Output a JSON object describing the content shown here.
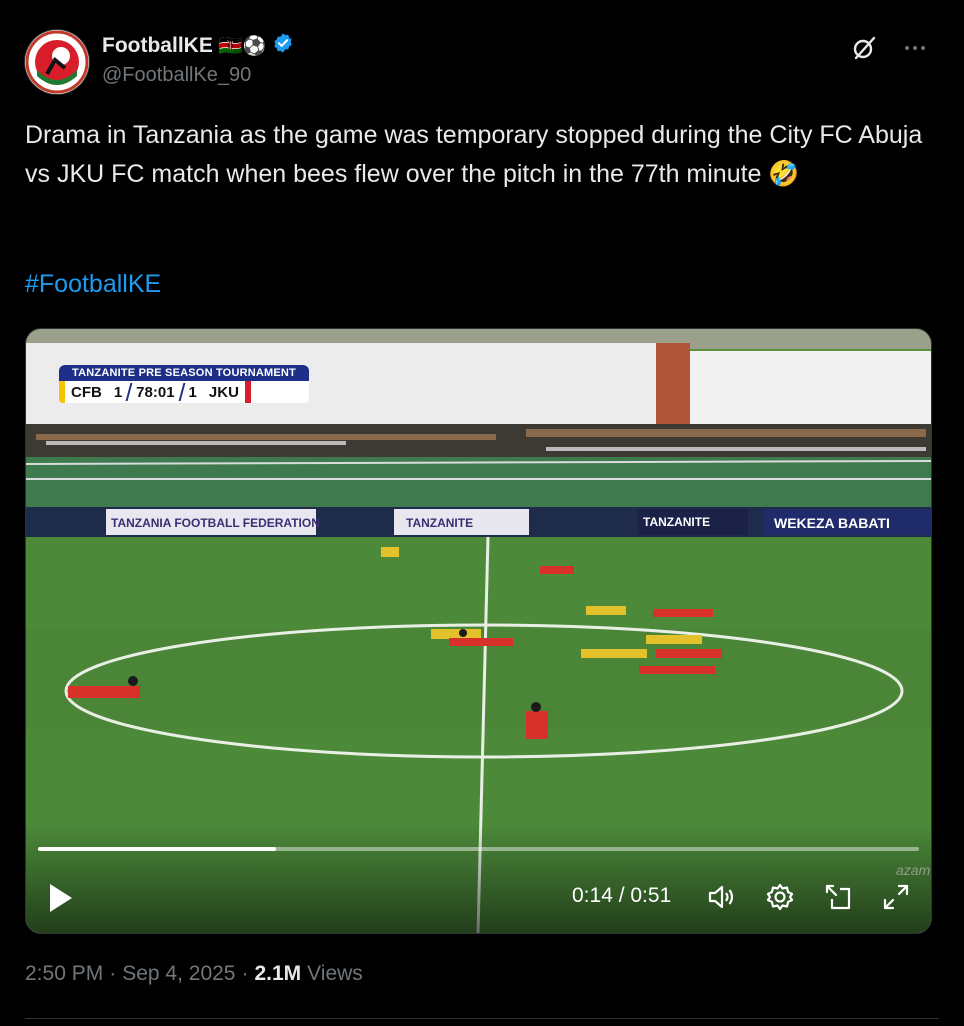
{
  "author": {
    "display_name": "FootballKE",
    "name_emojis": "🇰🇪⚽",
    "handle": "@FootballKe_90",
    "verified": true,
    "accent": "#1d9bf0"
  },
  "header_icons": [
    "grok-icon",
    "more-icon"
  ],
  "tweet": {
    "text": "Drama in Tanzania as the game was temporary stopped during the City FC Abuja vs JKU FC match when bees flew over the pitch in the 77th minute 🤣",
    "hashtag": "#FootballKE"
  },
  "video": {
    "scorebug": {
      "title": "TANZANITE PRE SEASON TOURNAMENT",
      "home_team": "CFB",
      "home_score": "1",
      "clock": "78:01",
      "away_score": "1",
      "away_team": "JKU"
    },
    "boards": [
      "TANZANIA FOOTBALL FEDERATION",
      "TANZANITE",
      "TANZANITE",
      "WEKEZA BABATI"
    ],
    "watermark": "azam",
    "progress_fraction": 0.27,
    "time_display": "0:14 / 0:51",
    "controls": [
      "play-icon",
      "volume-icon",
      "settings-icon",
      "pip-icon",
      "fullscreen-icon"
    ]
  },
  "meta": {
    "time": "2:50 PM",
    "date": "Sep 4, 2025",
    "views_count": "2.1M",
    "views_label": "Views"
  }
}
